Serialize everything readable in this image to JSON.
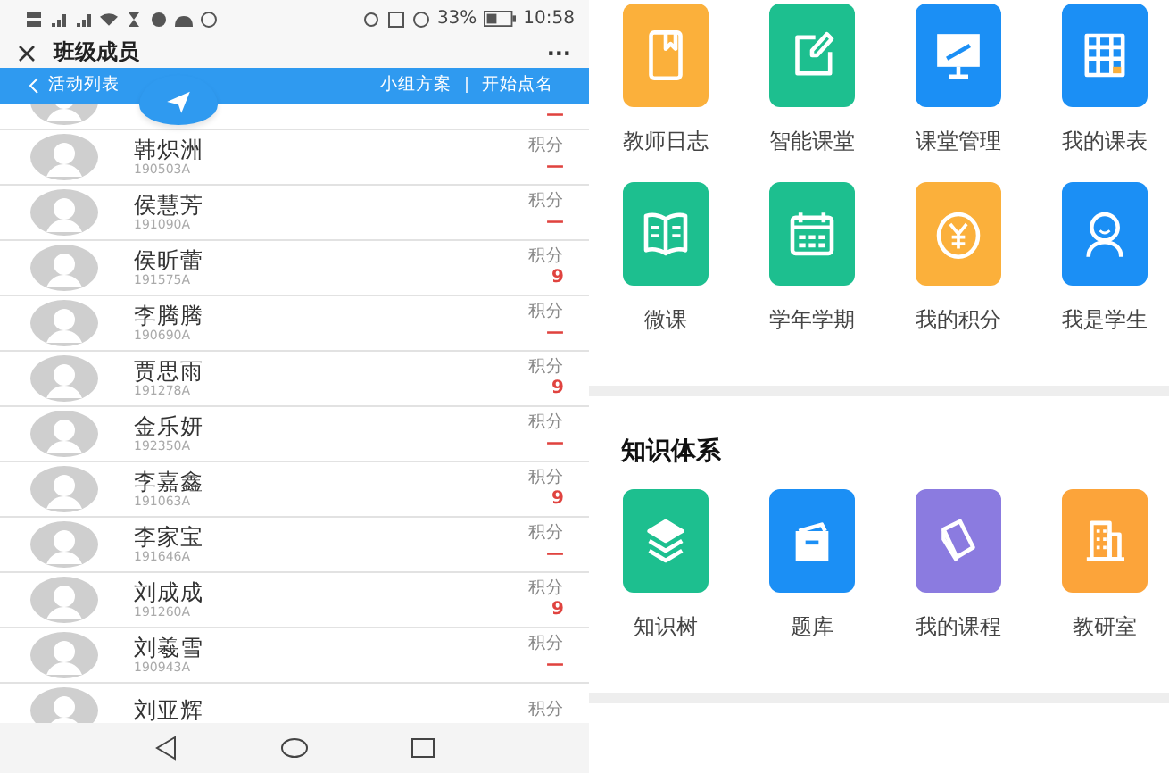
{
  "status_bar": {
    "battery": "33%",
    "time": "10:58"
  },
  "title_bar": {
    "title": "班级成员",
    "more": "···"
  },
  "action_bar": {
    "back": "活动列表",
    "actions": [
      "小组方案",
      "开始点名"
    ]
  },
  "top_row_score": "—",
  "members": [
    {
      "name": "韩炽洲",
      "id": "190503A",
      "label": "积分",
      "score": "—"
    },
    {
      "name": "侯慧芳",
      "id": "191090A",
      "label": "积分",
      "score": "—"
    },
    {
      "name": "侯昕蕾",
      "id": "191575A",
      "label": "积分",
      "score": "9"
    },
    {
      "name": "李腾腾",
      "id": "190690A",
      "label": "积分",
      "score": "—"
    },
    {
      "name": "贾思雨",
      "id": "191278A",
      "label": "积分",
      "score": "9"
    },
    {
      "name": "金乐妍",
      "id": "192350A",
      "label": "积分",
      "score": "—"
    },
    {
      "name": "李嘉鑫",
      "id": "191063A",
      "label": "积分",
      "score": "9"
    },
    {
      "name": "李家宝",
      "id": "191646A",
      "label": "积分",
      "score": "—"
    },
    {
      "name": "刘成成",
      "id": "191260A",
      "label": "积分",
      "score": "9"
    },
    {
      "name": "刘羲雪",
      "id": "190943A",
      "label": "积分",
      "score": "—"
    },
    {
      "name": "刘亚辉",
      "label": "积分"
    }
  ],
  "apps": [
    {
      "label": "教师日志",
      "kind": "book",
      "color": "#fbb03b"
    },
    {
      "label": "智能课堂",
      "kind": "edit",
      "color": "#1dbf8f"
    },
    {
      "label": "课堂管理",
      "kind": "monitor",
      "color": "#1b8ff5"
    },
    {
      "label": "我的课表",
      "kind": "table",
      "color": "#1b8ff5"
    },
    {
      "label": "微课",
      "kind": "openbook",
      "color": "#1dbf8f"
    },
    {
      "label": "学年学期",
      "kind": "calendar",
      "color": "#1dbf8f"
    },
    {
      "label": "我的积分",
      "kind": "coin",
      "color": "#fbb03b"
    },
    {
      "label": "我是学生",
      "kind": "person",
      "color": "#1b8ff5"
    }
  ],
  "knowledge": {
    "title": "知识体系",
    "items": [
      {
        "label": "知识树",
        "kind": "layers",
        "color": "#1dbf8f"
      },
      {
        "label": "题库",
        "kind": "box",
        "color": "#1b8ff5"
      },
      {
        "label": "我的课程",
        "kind": "notebook",
        "color": "#8b7be0"
      },
      {
        "label": "教研室",
        "kind": "building",
        "color": "#fca43a"
      }
    ]
  }
}
